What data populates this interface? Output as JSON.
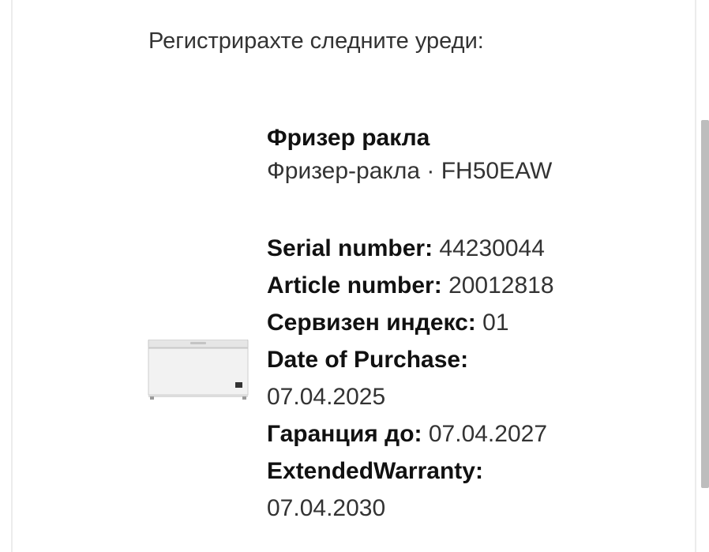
{
  "intro_text": "Регистрирахте следните уреди:",
  "device": {
    "name": "Фризер ракла",
    "type_model": "Фризер-ракла · FH50EAW",
    "serial_label": "Serial number:",
    "serial_value": "44230044",
    "article_label": "Article number:",
    "article_value": "20012818",
    "service_label": "Сервизен индекс:",
    "service_value": "01",
    "purchase_label": "Date of Purchase:",
    "purchase_value": "07.04.2025",
    "warranty_label": "Гаранция до:",
    "warranty_value": "07.04.2027",
    "ext_warranty_label": "ExtendedWarranty:",
    "ext_warranty_value": "07.04.2030"
  }
}
